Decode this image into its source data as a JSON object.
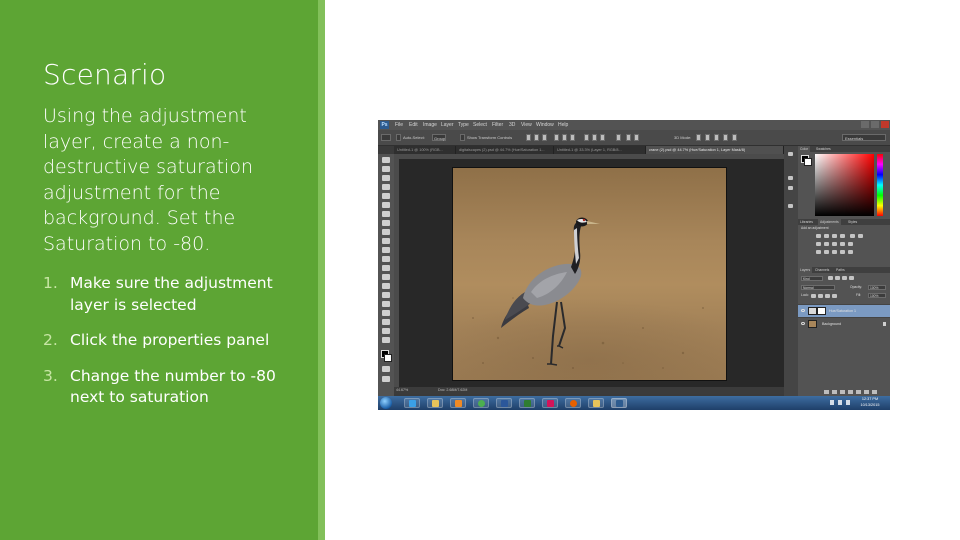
{
  "slide": {
    "title": "Scenario",
    "body": "Using the adjustment layer, create a non-destructive saturation adjustment for the background. Set the Saturation to -80.",
    "steps": [
      {
        "num": "1.",
        "text": "Make sure the adjustment layer is selected"
      },
      {
        "num": "2.",
        "text": "Click the properties panel"
      },
      {
        "num": "3.",
        "text": "Change the number to -80 next to saturation"
      }
    ]
  },
  "photoshop": {
    "logo": "Ps",
    "menu": [
      "File",
      "Edit",
      "Image",
      "Layer",
      "Type",
      "Select",
      "Filter",
      "3D",
      "View",
      "Window",
      "Help"
    ],
    "options": {
      "auto_select": "Auto-Select:",
      "auto_select_value": "Group",
      "show_transform": "Show Transform Controls",
      "mode_3d": "3D Mode:",
      "workspace": "Essentials"
    },
    "tabs": [
      "Untitled-1 @ 100% (RGB...",
      "digitalscapes (2).psd @ 44.7% (Hue/Saturation 1...",
      "Untitled-1 @ 33.3% (Layer 1, RGB/8...",
      "crane (2).psd @ 44.7% (Hue/Saturation 1, Layer Mask/8)"
    ],
    "status": {
      "zoom": "44.67%",
      "doc": "Doc: 2.68M/7.62M"
    },
    "panels": {
      "color_tabs": [
        "Color",
        "Swatches"
      ],
      "adjust_tabs": [
        "Libraries",
        "Adjustments",
        "Styles"
      ],
      "adjust_hint": "Add an adjustment",
      "layers_tabs": [
        "Layers",
        "Channels",
        "Paths"
      ],
      "kind": "Kind",
      "blend_mode": "Normal",
      "opacity_label": "Opacity:",
      "opacity": "100%",
      "lock_label": "Lock:",
      "fill_label": "Fill:",
      "fill": "100%",
      "layers": [
        {
          "name": "Hue/Saturation 1",
          "selected": true
        },
        {
          "name": "Background",
          "selected": false
        }
      ]
    },
    "taskbar": {
      "time": "12:37 PM",
      "date": "10/13/2015"
    }
  }
}
